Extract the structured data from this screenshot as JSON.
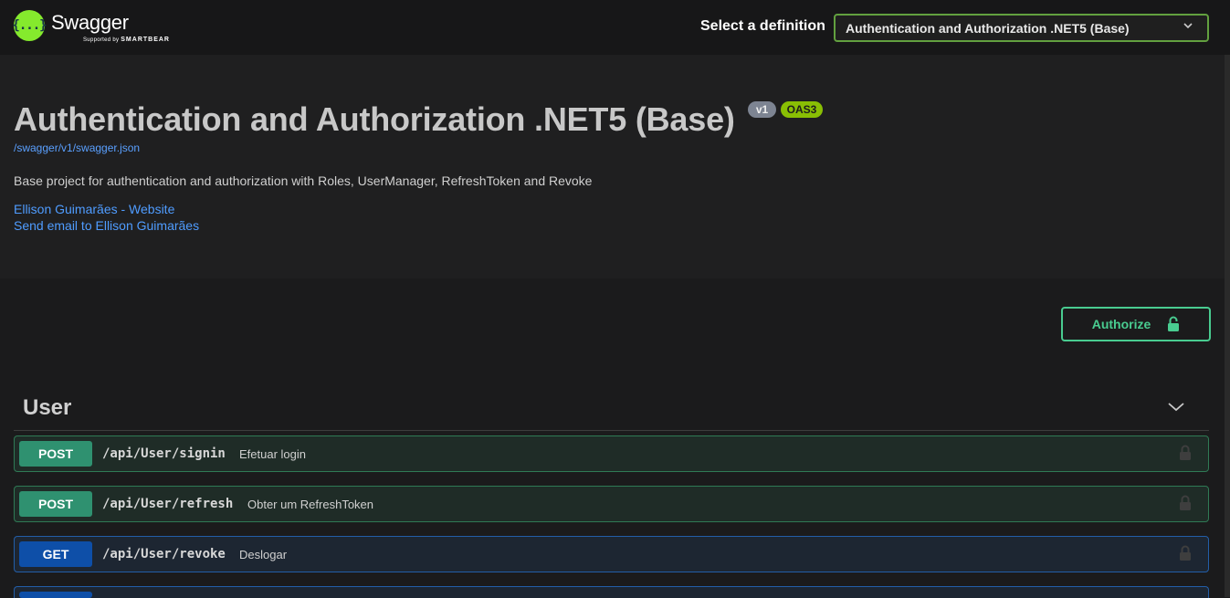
{
  "header": {
    "logo_title": "Swagger",
    "logo_sub_prefix": "Supported by",
    "logo_sub_brand": "SMARTBEAR",
    "logo_glyph": "{...}",
    "definition_label": "Select a definition",
    "definition_value": "Authentication and Authorization .NET5 (Base)"
  },
  "info": {
    "title": "Authentication and Authorization .NET5 (Base)",
    "version_badge": "v1",
    "oas_badge": "OAS3",
    "spec_url": "/swagger/v1/swagger.json",
    "description": "Base project for authentication and authorization with Roles, UserManager, RefreshToken and Revoke",
    "contact_website": "Ellison Guimarães - Website",
    "contact_email": "Send email to Ellison Guimarães"
  },
  "authorize": {
    "label": "Authorize"
  },
  "section": {
    "title": "User"
  },
  "operations": [
    {
      "method": "POST",
      "path": "/api/User/signin",
      "summary": "Efetuar login"
    },
    {
      "method": "POST",
      "path": "/api/User/refresh",
      "summary": "Obter um RefreshToken"
    },
    {
      "method": "GET",
      "path": "/api/User/revoke",
      "summary": "Deslogar"
    }
  ],
  "colors": {
    "post": "#49cc90",
    "get": "#61affe",
    "logo": "#85ea2d",
    "oas": "#89bf04"
  },
  "icons": [
    "swagger-logo-icon",
    "chevron-down-icon",
    "unlock-icon",
    "lock-icon"
  ]
}
